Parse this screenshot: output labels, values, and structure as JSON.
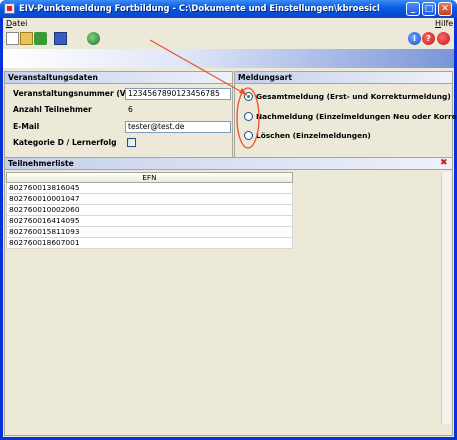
{
  "window": {
    "title": "EIV-Punktemeldung Fortbildung - C:\\Dokumente und Einstellungen\\kbroesicke\\Desktop\\test.xml *",
    "minimize": "_",
    "maximize": "□",
    "close": "✕"
  },
  "menu": {
    "file": "Datei",
    "help": "Hilfe"
  },
  "toolbar": {
    "icons": [
      "new-file-icon",
      "open-folder-icon",
      "download-icon",
      "save-icon",
      "globe-icon",
      "info-icon",
      "help-icon",
      "stop-icon"
    ],
    "info_glyph": "i",
    "help_glyph": "?"
  },
  "veranstaltung": {
    "header": "Veranstaltungsdaten",
    "vnr_label": "Veranstaltungsnummer (VNR)",
    "vnr_value": "1234567890123456785",
    "teilnehmer_label": "Anzahl Teilnehmer",
    "teilnehmer_value": "6",
    "email_label": "E-Mail",
    "email_value": "tester@test.de",
    "kategorie_label": "Kategorie D / Lernerfolg"
  },
  "meldungsart": {
    "header": "Meldungsart",
    "options": [
      {
        "label": "Gesamtmeldung (Erst- und Korrekturmeldung)",
        "selected": true
      },
      {
        "label": "Nachmeldung (Einzelmeldungen Neu oder Korrektur)",
        "selected": false
      },
      {
        "label": "Löschen (Einzelmeldungen)",
        "selected": false
      }
    ]
  },
  "teilnehmer": {
    "header": "Teilnehmerliste",
    "column": "EFN",
    "rows": [
      "802760013816045",
      "802760010001047",
      "802760010002060",
      "802760016414095",
      "802760015811093",
      "802760018607001"
    ]
  },
  "colors": {
    "annotation": "#e8502e",
    "titlebar": "#0a5fe6"
  }
}
